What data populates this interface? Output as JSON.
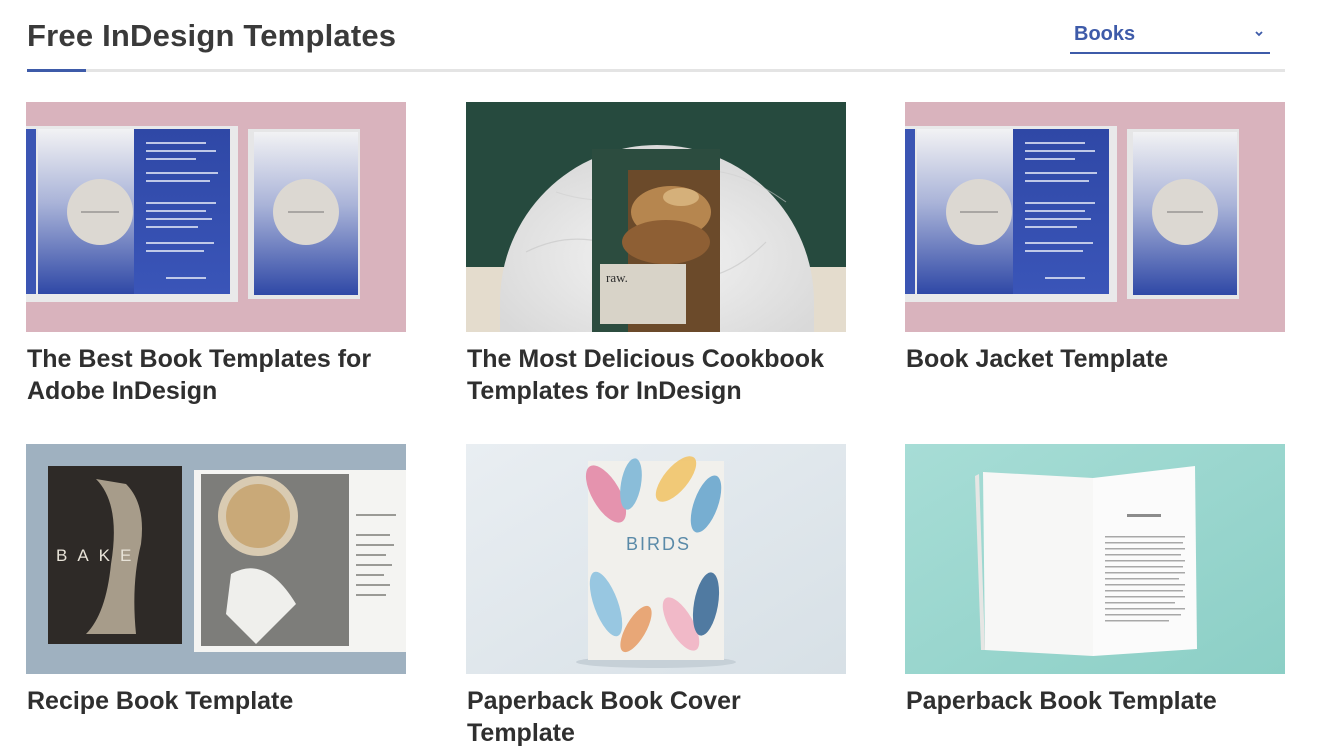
{
  "header": {
    "title": "Free InDesign Templates",
    "filter": {
      "selected": "Books"
    }
  },
  "colors": {
    "accent": "#3e5ba9",
    "rule": "#e4e4e4",
    "title_text": "#2f2f2f"
  },
  "cards": [
    {
      "title": "The Best Book Templates for Adobe InDesign",
      "image": "book-spread-pink-image"
    },
    {
      "title": "The Most Delicious Cookbook Templates for InDesign",
      "image": "cookbook-marble-image",
      "cover_text": "raw."
    },
    {
      "title": "Book Jacket Template",
      "image": "book-jacket-pink-image"
    },
    {
      "title": "Recipe Book Template",
      "image": "recipe-book-bake-image",
      "cover_text": "BAKE"
    },
    {
      "title": "Paperback Book Cover Template",
      "image": "birds-cover-image",
      "cover_text": "BIRDS"
    },
    {
      "title": "Paperback Book Template",
      "image": "paperback-open-teal-image"
    }
  ]
}
